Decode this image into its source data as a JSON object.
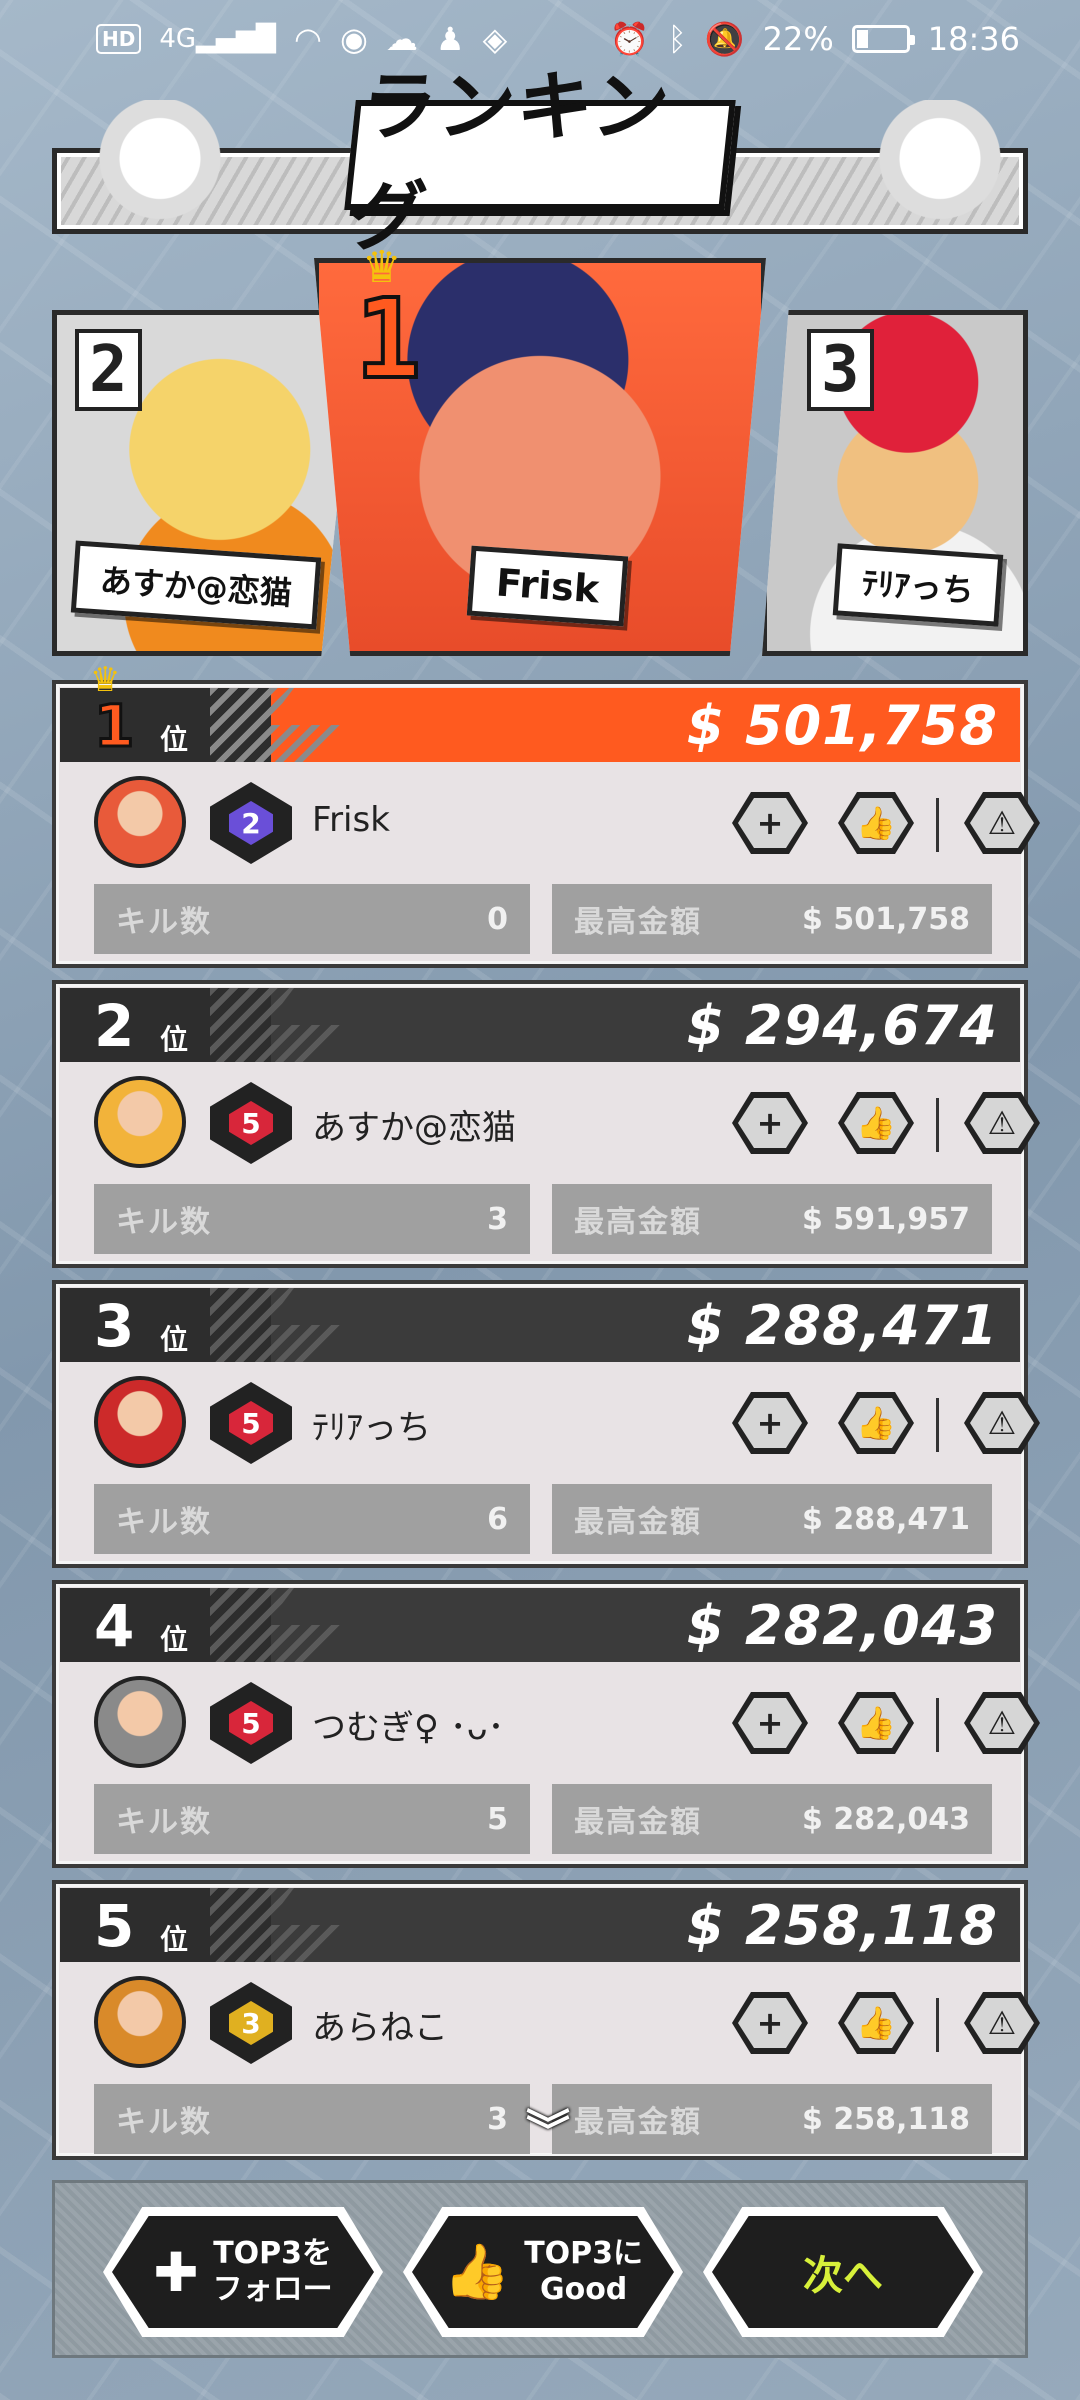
{
  "status_bar": {
    "hd": "HD",
    "network": "4G",
    "battery": "22%",
    "battery_fraction": 0.22,
    "time": "18:36"
  },
  "header": {
    "title": "ランキング"
  },
  "podium": [
    {
      "rank": "2",
      "name": "あすか@恋猫"
    },
    {
      "rank": "1",
      "name": "Frisk"
    },
    {
      "rank": "3",
      "name": "ﾃﾘｱっち"
    }
  ],
  "rank_suffix": "位",
  "labels": {
    "kills": "キル数",
    "max_money": "最高金額"
  },
  "rows": [
    {
      "rank": "1",
      "money": "$ 501,758",
      "name": "Frisk",
      "badge": "2",
      "badge_color": "#6a4fd8",
      "kills": "0",
      "max_money": "$ 501,758",
      "avatar_color": "#e85a3a"
    },
    {
      "rank": "2",
      "money": "$ 294,674",
      "name": "あすか@恋猫",
      "badge": "5",
      "badge_color": "#d8263a",
      "kills": "3",
      "max_money": "$ 591,957",
      "avatar_color": "#f2b33a"
    },
    {
      "rank": "3",
      "money": "$ 288,471",
      "name": "ﾃﾘｱっち",
      "badge": "5",
      "badge_color": "#d8263a",
      "kills": "6",
      "max_money": "$ 288,471",
      "avatar_color": "#cc2a2a"
    },
    {
      "rank": "4",
      "money": "$ 282,043",
      "name": "つむぎ♀ ･ᴗ･",
      "badge": "5",
      "badge_color": "#d8263a",
      "kills": "5",
      "max_money": "$ 282,043",
      "avatar_color": "#8a8a8a"
    },
    {
      "rank": "5",
      "money": "$ 258,118",
      "name": "あらねこ",
      "badge": "3",
      "badge_color": "#e0b020",
      "kills": "3",
      "max_money": "$ 258,118",
      "avatar_color": "#d98a2a"
    }
  ],
  "bottom": {
    "follow_label": "TOP3を\nフォロー",
    "good_label": "TOP3に\nGood",
    "next_label": "次へ"
  },
  "colors": {
    "accent": "#ff5a1f",
    "next_text": "#d7f03a"
  }
}
